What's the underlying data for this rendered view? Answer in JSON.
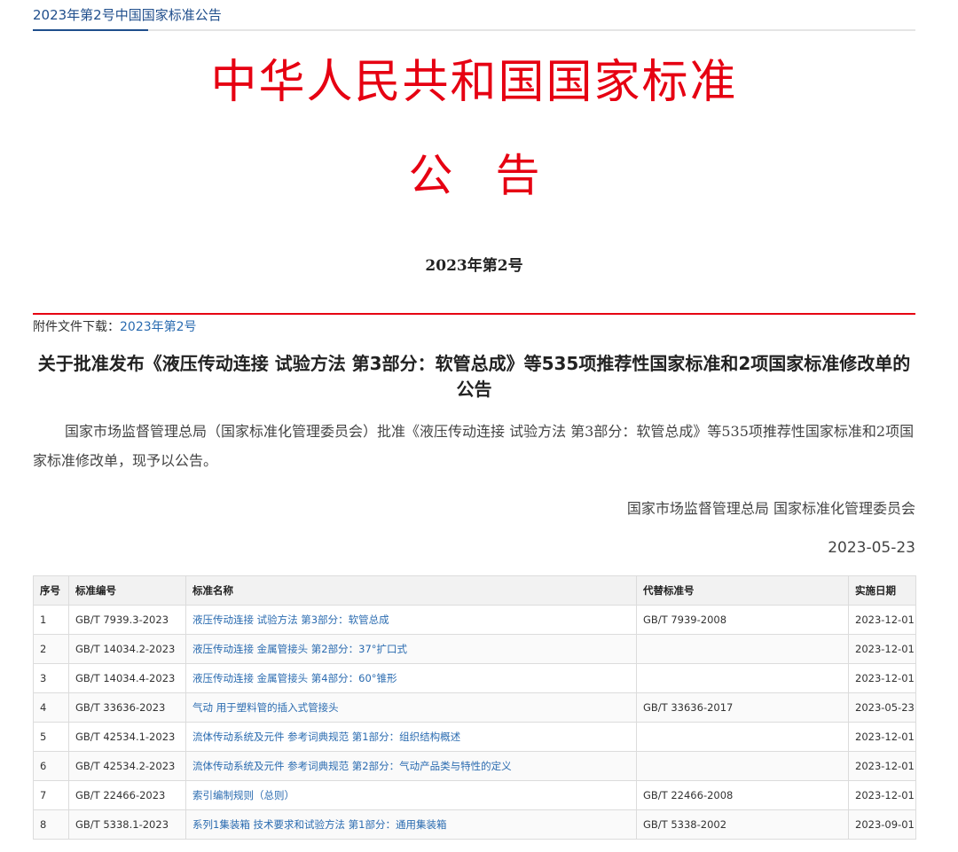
{
  "breadcrumb": "2023年第2号中国国家标准公告",
  "masthead": "中华人民共和国国家标准",
  "doc_type": "公告",
  "issue_no": "2023年第2号",
  "attachment": {
    "label": "附件文件下载：",
    "link": "2023年第2号"
  },
  "title": "关于批准发布《液压传动连接 试验方法 第3部分：软管总成》等535项推荐性国家标准和2项国家标准修改单的公告",
  "body": "国家市场监督管理总局（国家标准化管理委员会）批准《液压传动连接 试验方法 第3部分：软管总成》等535项推荐性国家标准和2项国家标准修改单，现予以公告。",
  "issuer": "国家市场监督管理总局 国家标准化管理委员会",
  "date": "2023-05-23",
  "table": {
    "headers": [
      "序号",
      "标准编号",
      "标准名称",
      "代替标准号",
      "实施日期"
    ],
    "rows": [
      [
        "1",
        "GB/T 7939.3-2023",
        "液压传动连接 试验方法 第3部分：软管总成",
        "GB/T 7939-2008",
        "2023-12-01"
      ],
      [
        "2",
        "GB/T 14034.2-2023",
        "液压传动连接 金属管接头 第2部分：37°扩口式",
        "",
        "2023-12-01"
      ],
      [
        "3",
        "GB/T 14034.4-2023",
        "液压传动连接 金属管接头 第4部分：60°锥形",
        "",
        "2023-12-01"
      ],
      [
        "4",
        "GB/T 33636-2023",
        "气动 用于塑料管的插入式管接头",
        "GB/T 33636-2017",
        "2023-05-23"
      ],
      [
        "5",
        "GB/T 42534.1-2023",
        "流体传动系统及元件 参考词典规范 第1部分：组织结构概述",
        "",
        "2023-12-01"
      ],
      [
        "6",
        "GB/T 42534.2-2023",
        "流体传动系统及元件 参考词典规范 第2部分：气动产品类与特性的定义",
        "",
        "2023-12-01"
      ],
      [
        "7",
        "GB/T 22466-2023",
        "索引编制规则（总则）",
        "GB/T 22466-2008",
        "2023-12-01"
      ],
      [
        "8",
        "GB/T 5338.1-2023",
        "系列1集装箱 技术要求和试验方法 第1部分：通用集装箱",
        "GB/T 5338-2002",
        "2023-09-01"
      ]
    ]
  }
}
